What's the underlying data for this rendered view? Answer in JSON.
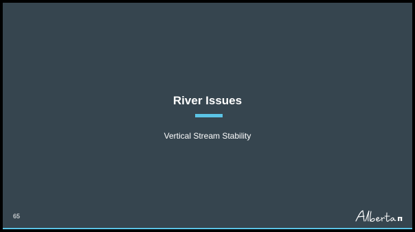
{
  "slide": {
    "title": "River Issues",
    "subtitle": "Vertical Stream Stability",
    "page_number": "65",
    "logo_text": "Alberta",
    "colors": {
      "background": "#36454f",
      "accent": "#5bc4e6",
      "text": "#ffffff"
    }
  }
}
